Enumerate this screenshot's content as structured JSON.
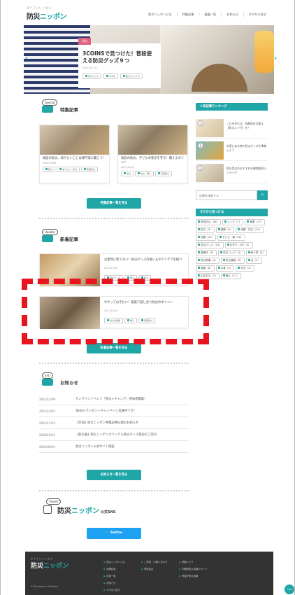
{
  "header": {
    "logo_small": "ぼうさいにっぽん",
    "logo_a": "防災",
    "logo_b": "ニッポン",
    "nav": [
      "防災ニッポンとは",
      "特集記事",
      "連載一覧",
      "お知らせ",
      "タグから探す"
    ]
  },
  "hero": {
    "badge": "初出",
    "title": "3COINSで見つけた！普段使える防災グッズ９つ",
    "date": "2021/11/24",
    "tags": [
      "防災グッズ",
      "100均",
      "備えのアイテム"
    ],
    "prev_icon": "chevron-left-icon",
    "next_icon": "chevron-right-icon"
  },
  "featured": {
    "badge": "Special",
    "title": "特集記事",
    "cards": [
      {
        "title": "家庭の防災、知りたいことは専門家に聞こう！",
        "date": "2021/12/08",
        "tags": [
          "防災",
          "ぼうさい・防災",
          "家庭防災"
        ]
      },
      {
        "title": "家庭の防災、子どもの安全を守る！備えるポイント",
        "date": "2021/12/03",
        "tags": [
          "防災",
          "防災・備え",
          "家庭防災"
        ]
      }
    ],
    "more_button": "特集記事一覧を見る"
  },
  "latest": {
    "badge": "Update",
    "title": "新着記事",
    "cards": [
      {
        "title": "災害時に慌てない！防災グッズの使い方やアイデアを紹介",
        "date": "2021/12/08",
        "tags": [
          "防災グッズ",
          "備え",
          "防災"
        ]
      },
      {
        "title": "今やっておきたい！家族で話し合う防災のポイント",
        "date": "2021/12/03",
        "tags": [
          "防災の知識",
          "備え",
          "家庭防災"
        ]
      }
    ],
    "more_button": "新着記事一覧を見る"
  },
  "news": {
    "badge": "Info",
    "title": "お知らせ",
    "rows": [
      {
        "date": "2021/12/09",
        "text": "オンラインイベント「防災×キャンプ」参加者募集！"
      },
      {
        "date": "2021/12/01",
        "text": "Twitterプレゼントキャンペーン実施中です！"
      },
      {
        "date": "2021/11/10",
        "text": "【告知】防災ニッポン特集記事公開のお知らせ"
      },
      {
        "date": "2020/10/31",
        "text": "【新企画】防災ニッポンオリジナル防災グッズ発売のご案内"
      },
      {
        "date": "2020/09/01",
        "text": "防災ニッポン公式サイト開設"
      }
    ],
    "more_button": "お知らせ一覧を見る"
  },
  "twitter_section": {
    "badge": "Tweet!",
    "logo_a": "防災",
    "logo_b": "ニッポン",
    "suffix": "公式SNS",
    "button": "Twitter"
  },
  "sidebar": {
    "ranking_title": "人気記事ランキング",
    "ranking": [
      {
        "num": "1",
        "title": "これを作れば、長期保存可能な【防災レシピ】を！"
      },
      {
        "num": "2",
        "title": "お家にある物で防災グッズを準備しよう"
      },
      {
        "num": "3",
        "title": "防災用品のおすすめを徹底解説ランキング"
      }
    ],
    "search_placeholder": "記事を検索する",
    "tags_title": "タグから見つける",
    "tags": [
      "家族防災（46）",
      "レシピ（7）",
      "備蓄（17）",
      "防災（3）",
      "避難（9）",
      "地震・防災（10）",
      "地震（34）",
      "子ども・備（26）",
      "防災グッズ（24）",
      "手作り・DIY（4）",
      "避難所（4）",
      "防災バッグ（4）",
      "食べ物（4）",
      "防災準備（4）",
      "防災情報（3）",
      "台（1）",
      "健康（8）",
      "水害（5）",
      "安全（2）",
      "応急手当（5）",
      "備え（17）"
    ]
  },
  "footer": {
    "logo_small": "ぼうさいにっぽん",
    "logo_a": "防災",
    "logo_b": "ニッポン",
    "copyright": "© The Yomiuri Shimbun",
    "col1": [
      "防災ニッポンとは",
      "特集記事",
      "記事一覧",
      "お知らせ",
      "タグから探す"
    ],
    "col2": [
      "ご意見・お問い合わせ",
      "運営会社"
    ],
    "col3": [
      "関連リンク",
      "内閣府防災情報のページ",
      "気象庁防災情報"
    ],
    "totop": "TOP"
  }
}
